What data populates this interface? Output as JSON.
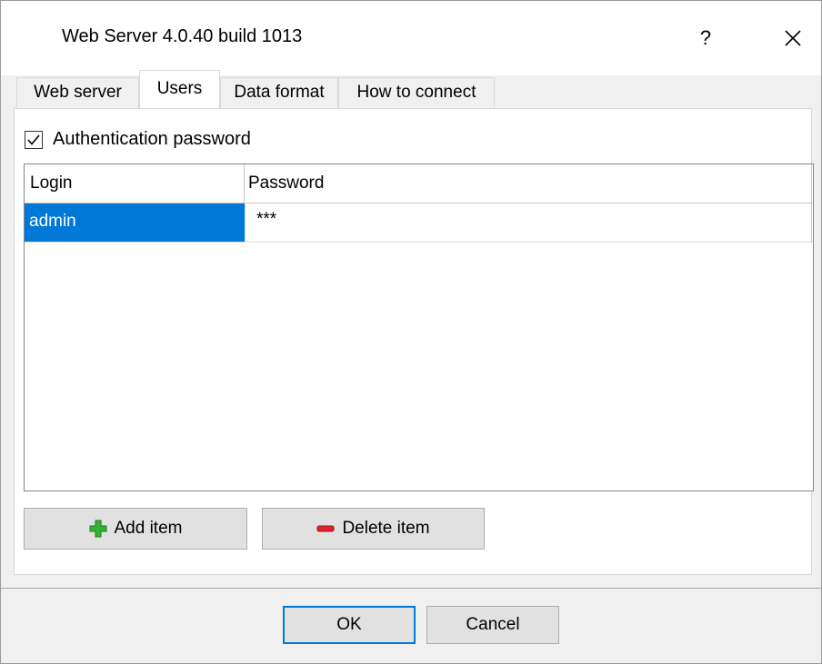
{
  "window": {
    "title": "Web Server 4.0.40 build 1013",
    "help_glyph": "?"
  },
  "tabs": [
    {
      "label": "Web server",
      "active": false
    },
    {
      "label": "Users",
      "active": true
    },
    {
      "label": "Data format",
      "active": false
    },
    {
      "label": "How to connect",
      "active": false
    }
  ],
  "auth": {
    "label": "Authentication password",
    "checked": true
  },
  "grid": {
    "columns": [
      "Login",
      "Password"
    ],
    "rows": [
      {
        "login": "admin",
        "password": "***",
        "selected": true
      }
    ]
  },
  "actions": {
    "add_label": "Add item",
    "delete_label": "Delete item"
  },
  "footer": {
    "ok_label": "OK",
    "cancel_label": "Cancel"
  },
  "colors": {
    "selection": "#0078d7",
    "add_icon": "#34b233",
    "delete_icon": "#e0202a"
  }
}
